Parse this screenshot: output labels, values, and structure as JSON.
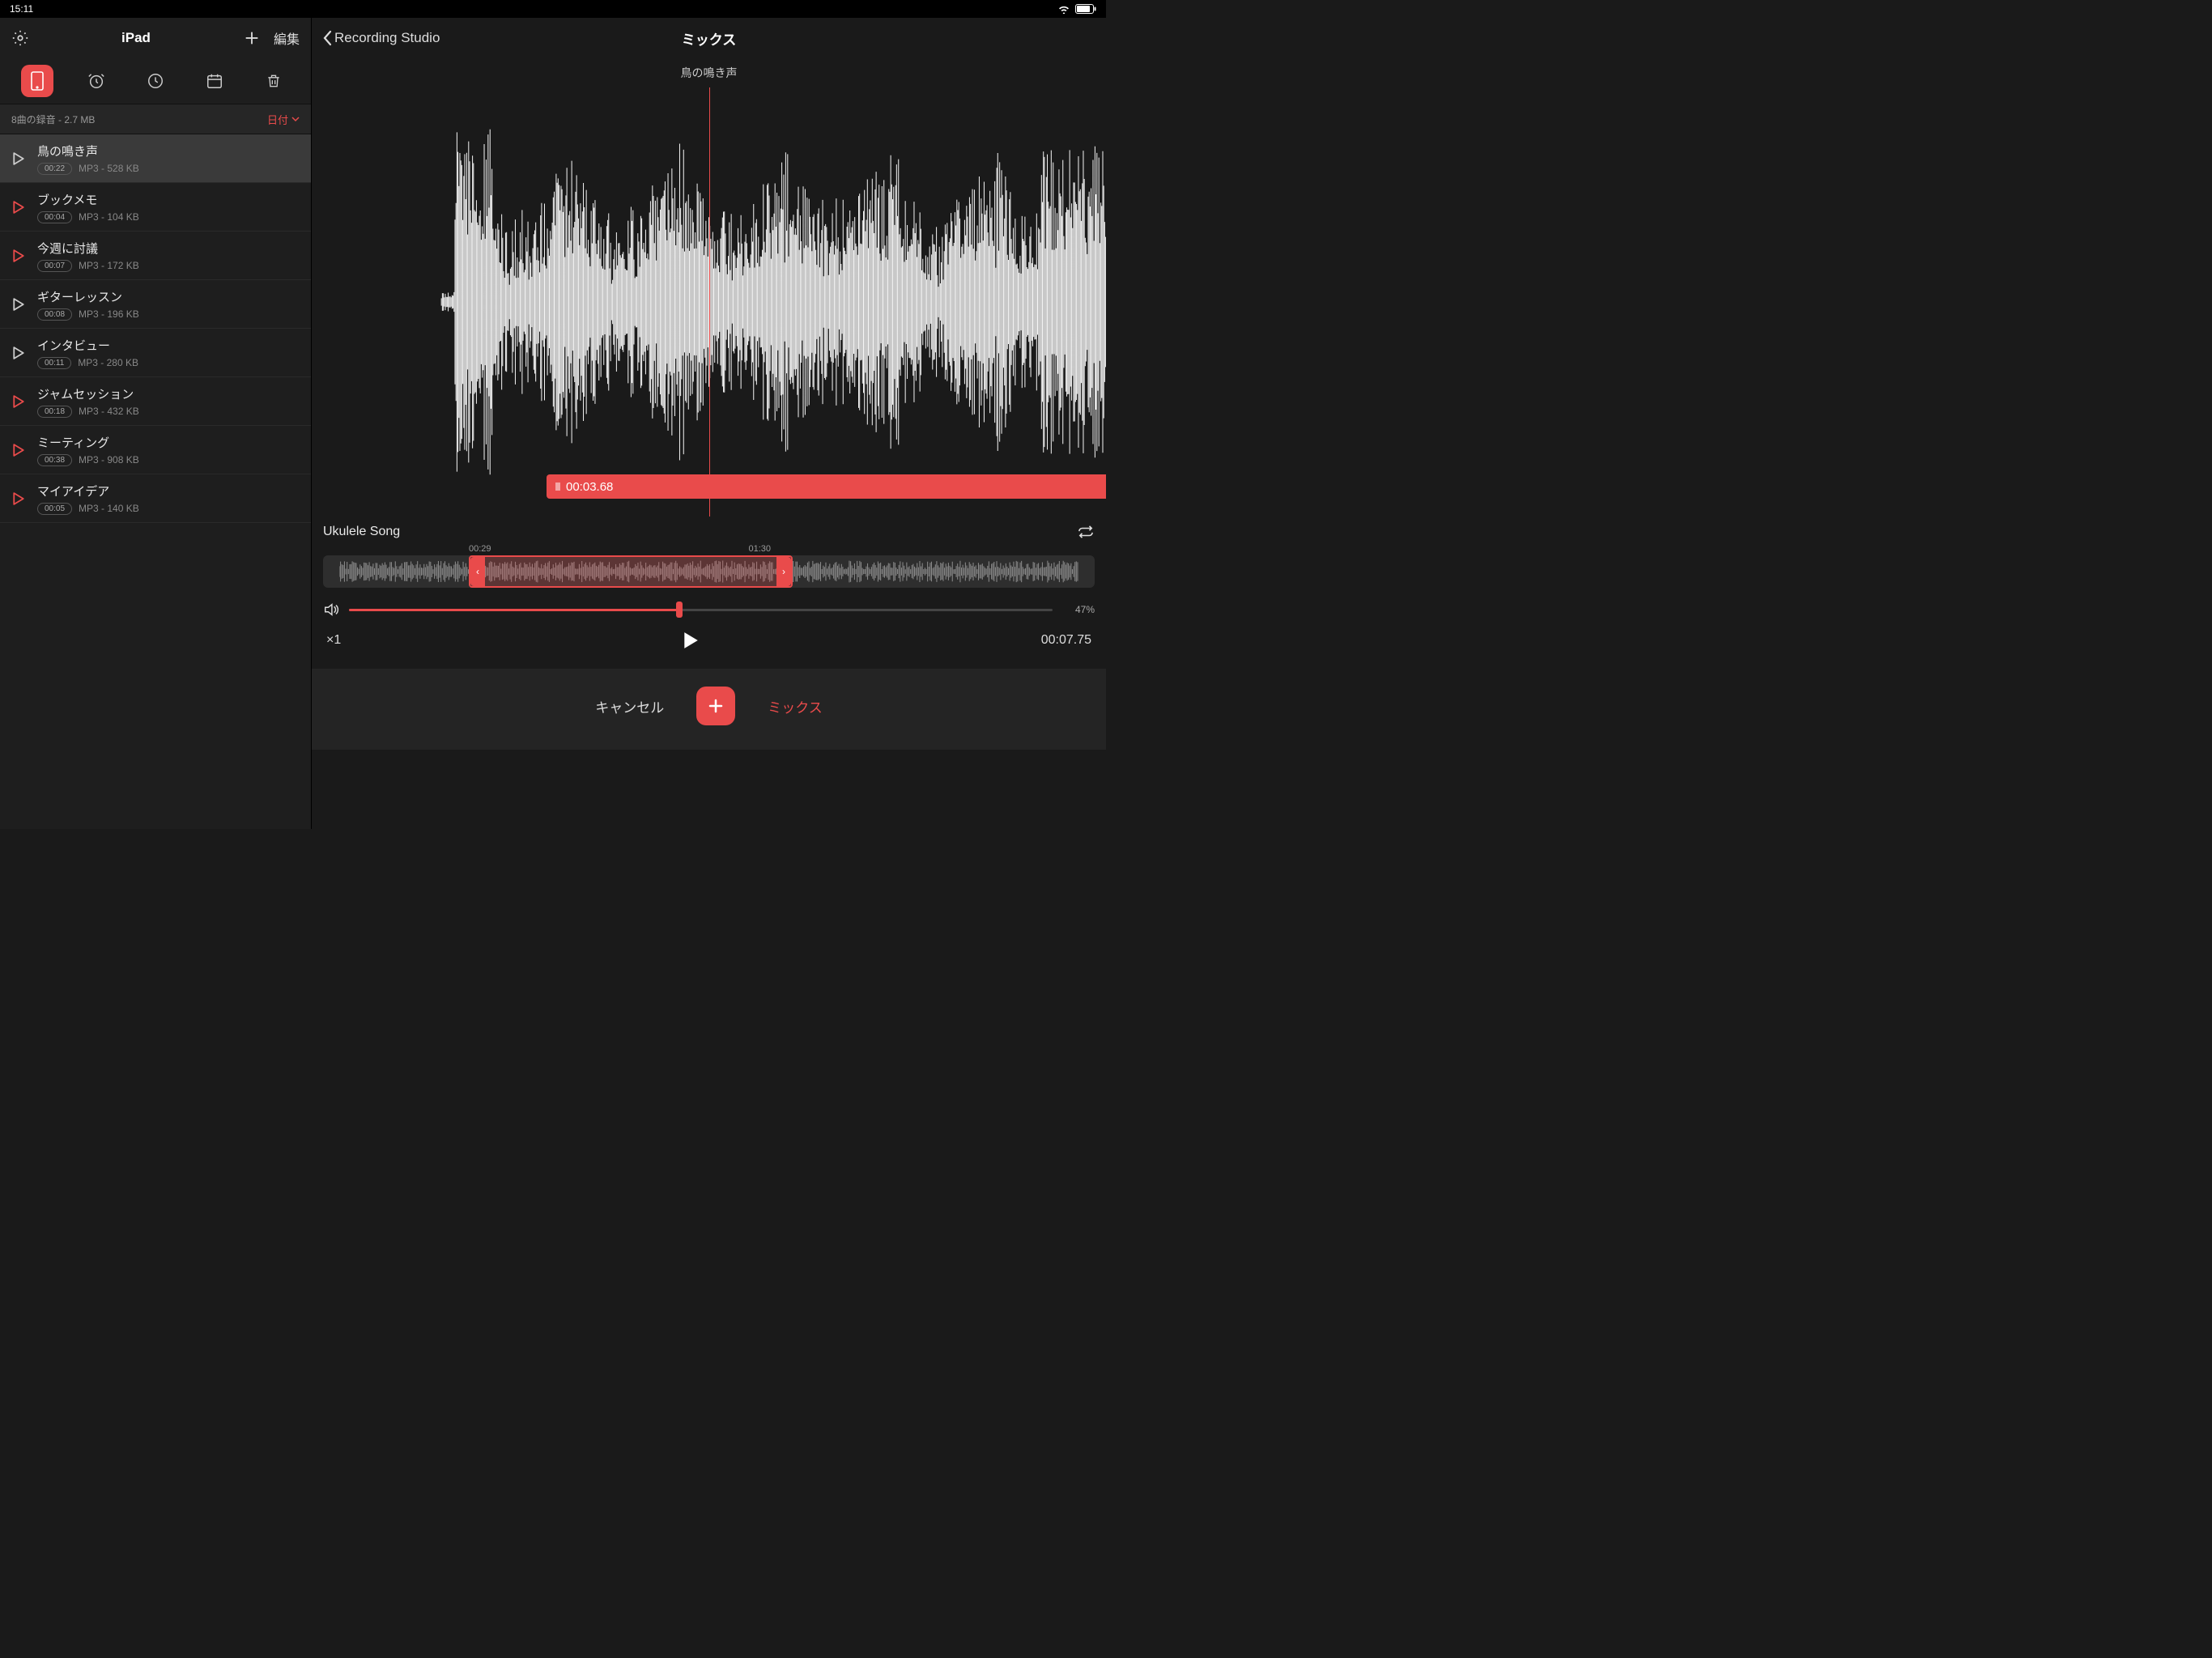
{
  "status": {
    "time": "15:11"
  },
  "sidebar": {
    "title": "iPad",
    "edit_label": "編集",
    "info_left": "8曲の録音 - 2.7 MB",
    "sort_label": "日付",
    "recordings": [
      {
        "title": "鳥の鳴き声",
        "duration": "00:22",
        "meta": "MP3 - 528 KB",
        "selected": true,
        "accent": false
      },
      {
        "title": "ブックメモ",
        "duration": "00:04",
        "meta": "MP3 - 104 KB",
        "selected": false,
        "accent": true
      },
      {
        "title": "今週に討議",
        "duration": "00:07",
        "meta": "MP3 - 172 KB",
        "selected": false,
        "accent": true
      },
      {
        "title": "ギターレッスン",
        "duration": "00:08",
        "meta": "MP3 - 196 KB",
        "selected": false,
        "accent": false
      },
      {
        "title": "インタビュー",
        "duration": "00:11",
        "meta": "MP3 - 280 KB",
        "selected": false,
        "accent": false
      },
      {
        "title": "ジャムセッション",
        "duration": "00:18",
        "meta": "MP3 - 432 KB",
        "selected": false,
        "accent": true
      },
      {
        "title": "ミーティング",
        "duration": "00:38",
        "meta": "MP3 - 908 KB",
        "selected": false,
        "accent": true
      },
      {
        "title": "マイアイデア",
        "duration": "00:05",
        "meta": "MP3 - 140 KB",
        "selected": false,
        "accent": true
      }
    ]
  },
  "main": {
    "back_label": "Recording Studio",
    "title": "ミックス",
    "wave_title": "鳥の鳴き声",
    "time_badge": "00:03.68",
    "mix_name": "Ukulele Song",
    "mix_time_start": "00:29",
    "mix_time_end": "01:30",
    "volume_pct": "47%",
    "speed": "×1",
    "playback_time": "00:07.75",
    "cancel_label": "キャンセル",
    "mix_label": "ミックス"
  }
}
